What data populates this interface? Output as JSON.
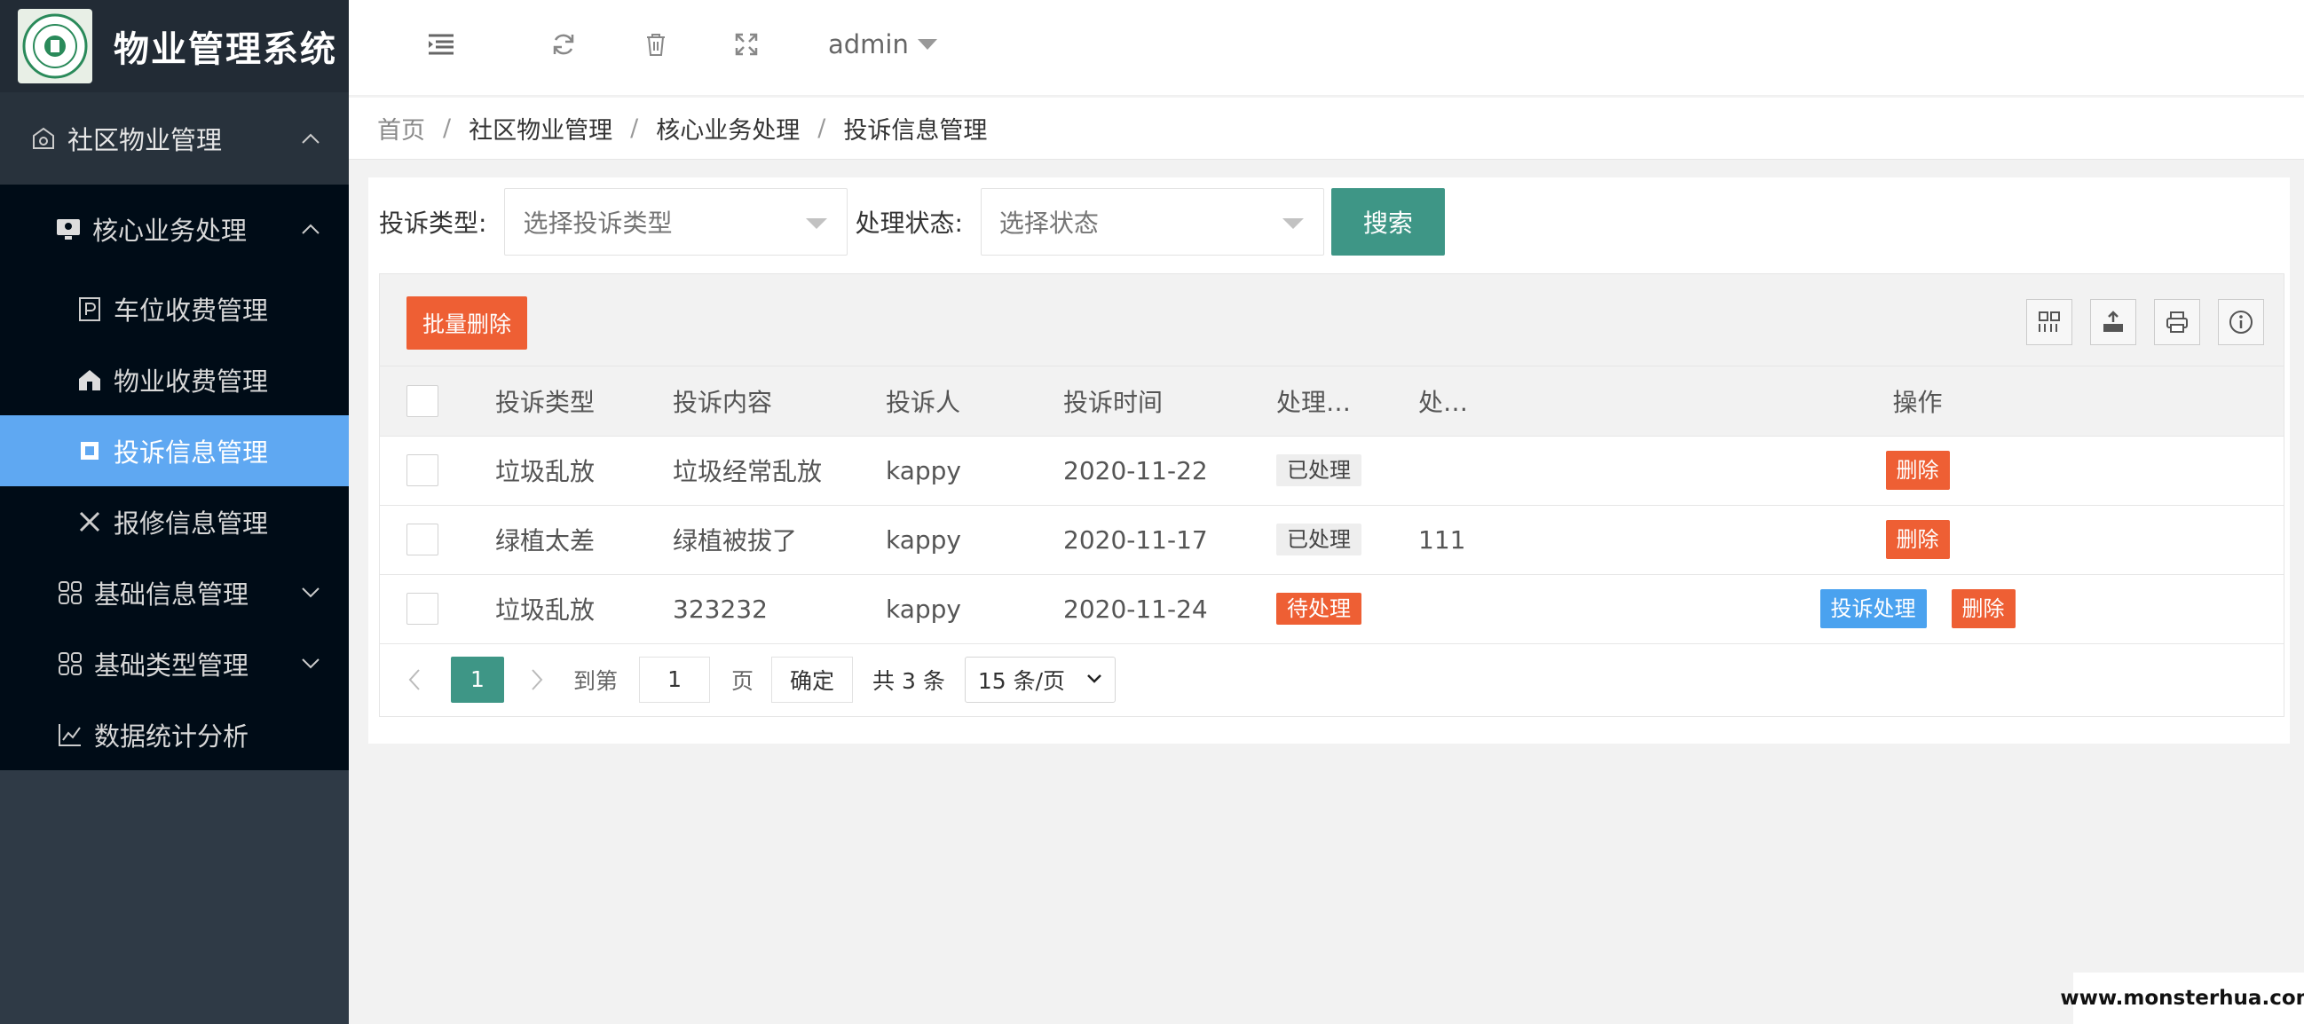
{
  "app": {
    "title": "物业管理系统"
  },
  "sidebar": {
    "top": {
      "label": "社区物业管理",
      "icon": "community-icon"
    },
    "core": {
      "label": "核心业务处理",
      "icon": "monitor-icon"
    },
    "leaves": [
      {
        "label": "车位收费管理",
        "icon": "parking-icon"
      },
      {
        "label": "物业收费管理",
        "icon": "house-icon"
      },
      {
        "label": "投诉信息管理",
        "icon": "complaint-icon"
      },
      {
        "label": "报修信息管理",
        "icon": "tools-icon"
      }
    ],
    "groups": [
      {
        "label": "基础信息管理",
        "icon": "grid-icon"
      },
      {
        "label": "基础类型管理",
        "icon": "grid-icon"
      },
      {
        "label": "数据统计分析",
        "icon": "line-chart-icon"
      }
    ]
  },
  "header": {
    "user": "admin"
  },
  "breadcrumb": [
    "首页",
    "社区物业管理",
    "核心业务处理",
    "投诉信息管理"
  ],
  "filters": {
    "type_label": "投诉类型:",
    "type_placeholder": "选择投诉类型",
    "status_label": "处理状态:",
    "status_placeholder": "选择状态",
    "search_label": "搜索"
  },
  "toolbar": {
    "batch_delete": "批量删除"
  },
  "table": {
    "headers": [
      "投诉类型",
      "投诉内容",
      "投诉人",
      "投诉时间",
      "处理…",
      "处…",
      "操作"
    ],
    "rows": [
      {
        "type": "垃圾乱放",
        "content": "垃圾经常乱放",
        "person": "kappy",
        "time": "2020-11-22",
        "status": "已处理",
        "result": "",
        "actions": [
          "删除"
        ]
      },
      {
        "type": "绿植太差",
        "content": "绿植被拔了",
        "person": "kappy",
        "time": "2020-11-17",
        "status": "已处理",
        "result": "111",
        "actions": [
          "删除"
        ]
      },
      {
        "type": "垃圾乱放",
        "content": "323232",
        "person": "kappy",
        "time": "2020-11-24",
        "status": "待处理",
        "result": "",
        "actions": [
          "投诉处理",
          "删除"
        ]
      }
    ]
  },
  "pager": {
    "current": "1",
    "goto_label": "到第",
    "goto_value": "1",
    "page_unit": "页",
    "confirm": "确定",
    "total": "共 3 条",
    "page_size": "15 条/页"
  },
  "watermark": "www.monsterhua.com",
  "colors": {
    "primary": "#3e9686",
    "danger": "#ee5f34",
    "info": "#4aa2ef",
    "active_menu": "#5fa8f2"
  }
}
